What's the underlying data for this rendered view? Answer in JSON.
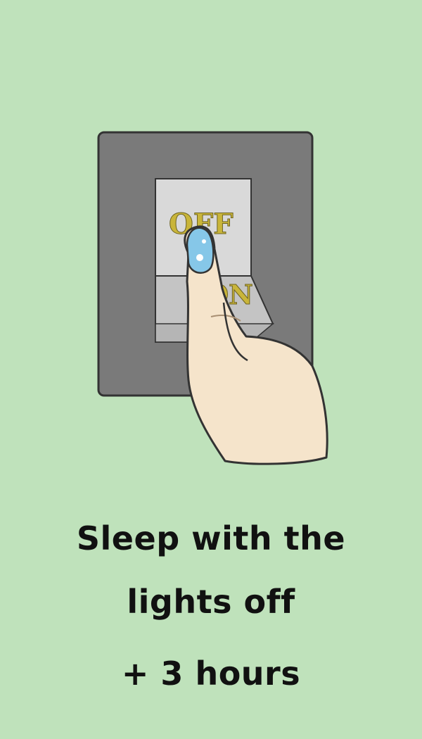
{
  "illustration": {
    "icon": "hand-turning-off-light-switch-icon",
    "switch_labels": {
      "off": "OFF",
      "on": "ON"
    },
    "colors": {
      "background": "#bfe2bb",
      "switch_plate": "#7a7a7a",
      "toggle": "#d9d9d9",
      "label_gold": "#c9b53a",
      "skin": "#f5e4cb",
      "nail": "#86c7e8"
    }
  },
  "caption": {
    "line1": "Sleep with the",
    "line2": "lights off",
    "bonus": "+ 3 hours"
  }
}
